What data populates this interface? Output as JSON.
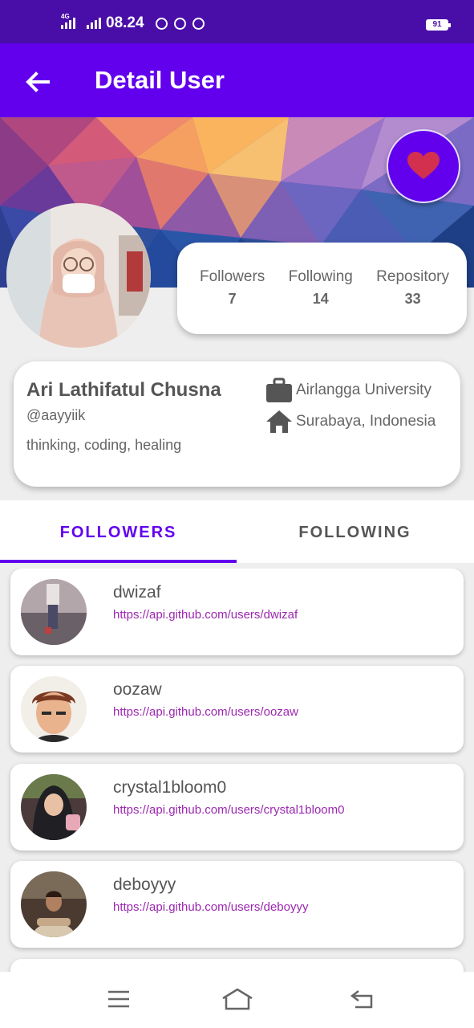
{
  "status_bar": {
    "time": "08.24",
    "network": "4G",
    "battery": "91"
  },
  "header": {
    "title": "Detail User"
  },
  "stats": [
    {
      "label": "Followers",
      "value": "7"
    },
    {
      "label": "Following",
      "value": "14"
    },
    {
      "label": "Repository",
      "value": "33"
    }
  ],
  "profile": {
    "name": "Ari Lathifatul Chusna",
    "username": "@aayyiik",
    "bio": "thinking, coding, healing",
    "company": "Airlangga University",
    "location": "Surabaya, Indonesia"
  },
  "tabs": [
    {
      "label": "FOLLOWERS"
    },
    {
      "label": "FOLLOWING"
    }
  ],
  "users": [
    {
      "login": "dwizaf",
      "url": "https://api.github.com/users/dwizaf"
    },
    {
      "login": "oozaw",
      "url": "https://api.github.com/users/oozaw"
    },
    {
      "login": "crystal1bloom0",
      "url": "https://api.github.com/users/crystal1bloom0"
    },
    {
      "login": "deboyyy",
      "url": "https://api.github.com/users/deboyyy"
    }
  ],
  "icons": {
    "back": "arrow-back-icon",
    "favorite": "heart-icon",
    "company": "briefcase-icon",
    "location": "home-icon",
    "menu": "menu-icon",
    "home": "home-nav-icon",
    "back_nav": "back-nav-icon"
  },
  "colors": {
    "primary": "#6200ee",
    "status_bar": "#4a0ea8",
    "heart": "#d32f4f",
    "link": "#9c27b0"
  }
}
